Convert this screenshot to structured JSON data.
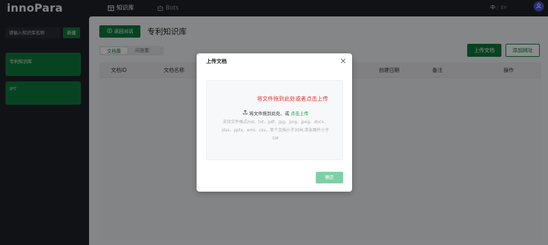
{
  "app": {
    "logo": "innoPara"
  },
  "nav": {
    "knowledge_base": "知识库",
    "bots": "Bots"
  },
  "lang": {
    "zh": "中",
    "sep": "|",
    "en": "En"
  },
  "sidebar": {
    "search_placeholder": "请输入知识库名称",
    "new_button": "新建",
    "items": [
      {
        "label": "专利知识库"
      },
      {
        "label": "IPT"
      }
    ]
  },
  "main": {
    "back_button": "返回对话",
    "title": "专利知识库",
    "tabs": [
      {
        "label": "文档集",
        "active": true
      },
      {
        "label": "问答集",
        "active": false
      }
    ],
    "upload_button": "上传文档",
    "add_url_button": "添加网址",
    "table": {
      "columns": [
        "文档ID",
        "文档名称",
        "创建日期",
        "备注",
        "操作"
      ]
    }
  },
  "modal": {
    "title": "上传文档",
    "drop_hint": "将文件拖到此处或者点击上传",
    "drop_text": "将文件拖到此处、或",
    "drop_link": "点击上传",
    "formats_text": "支持文件格式md、txt、pdf、jpg、png、jpeg、docx、xlsx、pptx、eml、csv，单个文档小于30M,单张图片小于5M",
    "confirm_button": "确定"
  },
  "colors": {
    "brand_green": "#0f7a3c",
    "confirm_disabled": "#7fcfa6",
    "hint_red": "#e0342f",
    "link_green": "#0f9a4a",
    "avatar_blue": "#4b57d6"
  }
}
